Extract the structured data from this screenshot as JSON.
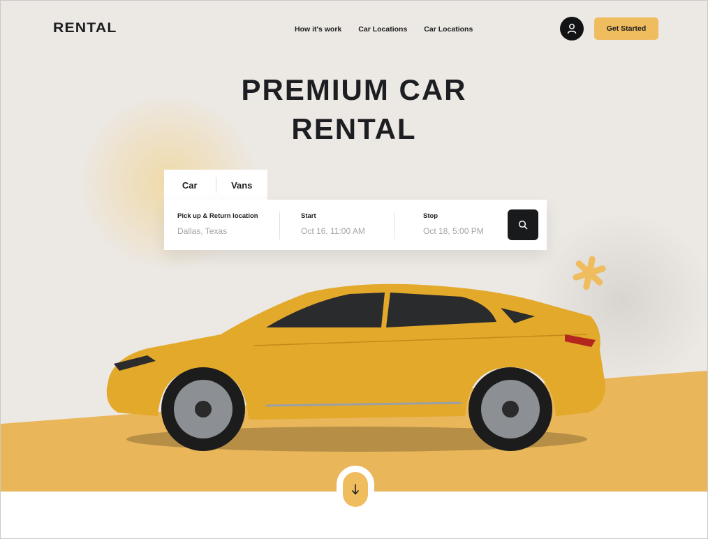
{
  "header": {
    "logo": "RENTAL",
    "nav": [
      "How it's work",
      "Car Locations",
      "Car Locations"
    ],
    "cta": "Get Started"
  },
  "hero": {
    "title_line1": "PREMIUM CAR",
    "title_line2": "RENTAL"
  },
  "booking": {
    "tabs": [
      "Car",
      "Vans"
    ],
    "location": {
      "label": "Pick up & Return location",
      "value": "Dallas, Texas"
    },
    "start": {
      "label": "Start",
      "value": "Oct 16, 11:00 AM"
    },
    "stop": {
      "label": "Stop",
      "value": "Oct 18, 5:00 PM"
    }
  },
  "icons": {
    "user": "user-icon",
    "search": "search-icon",
    "asterisk": "asterisk-icon",
    "scroll": "arrow-down-icon"
  },
  "colors": {
    "accent": "#efbc5e",
    "dark": "#191a1c",
    "background": "#ece8e4",
    "car": "#e3a92b"
  }
}
